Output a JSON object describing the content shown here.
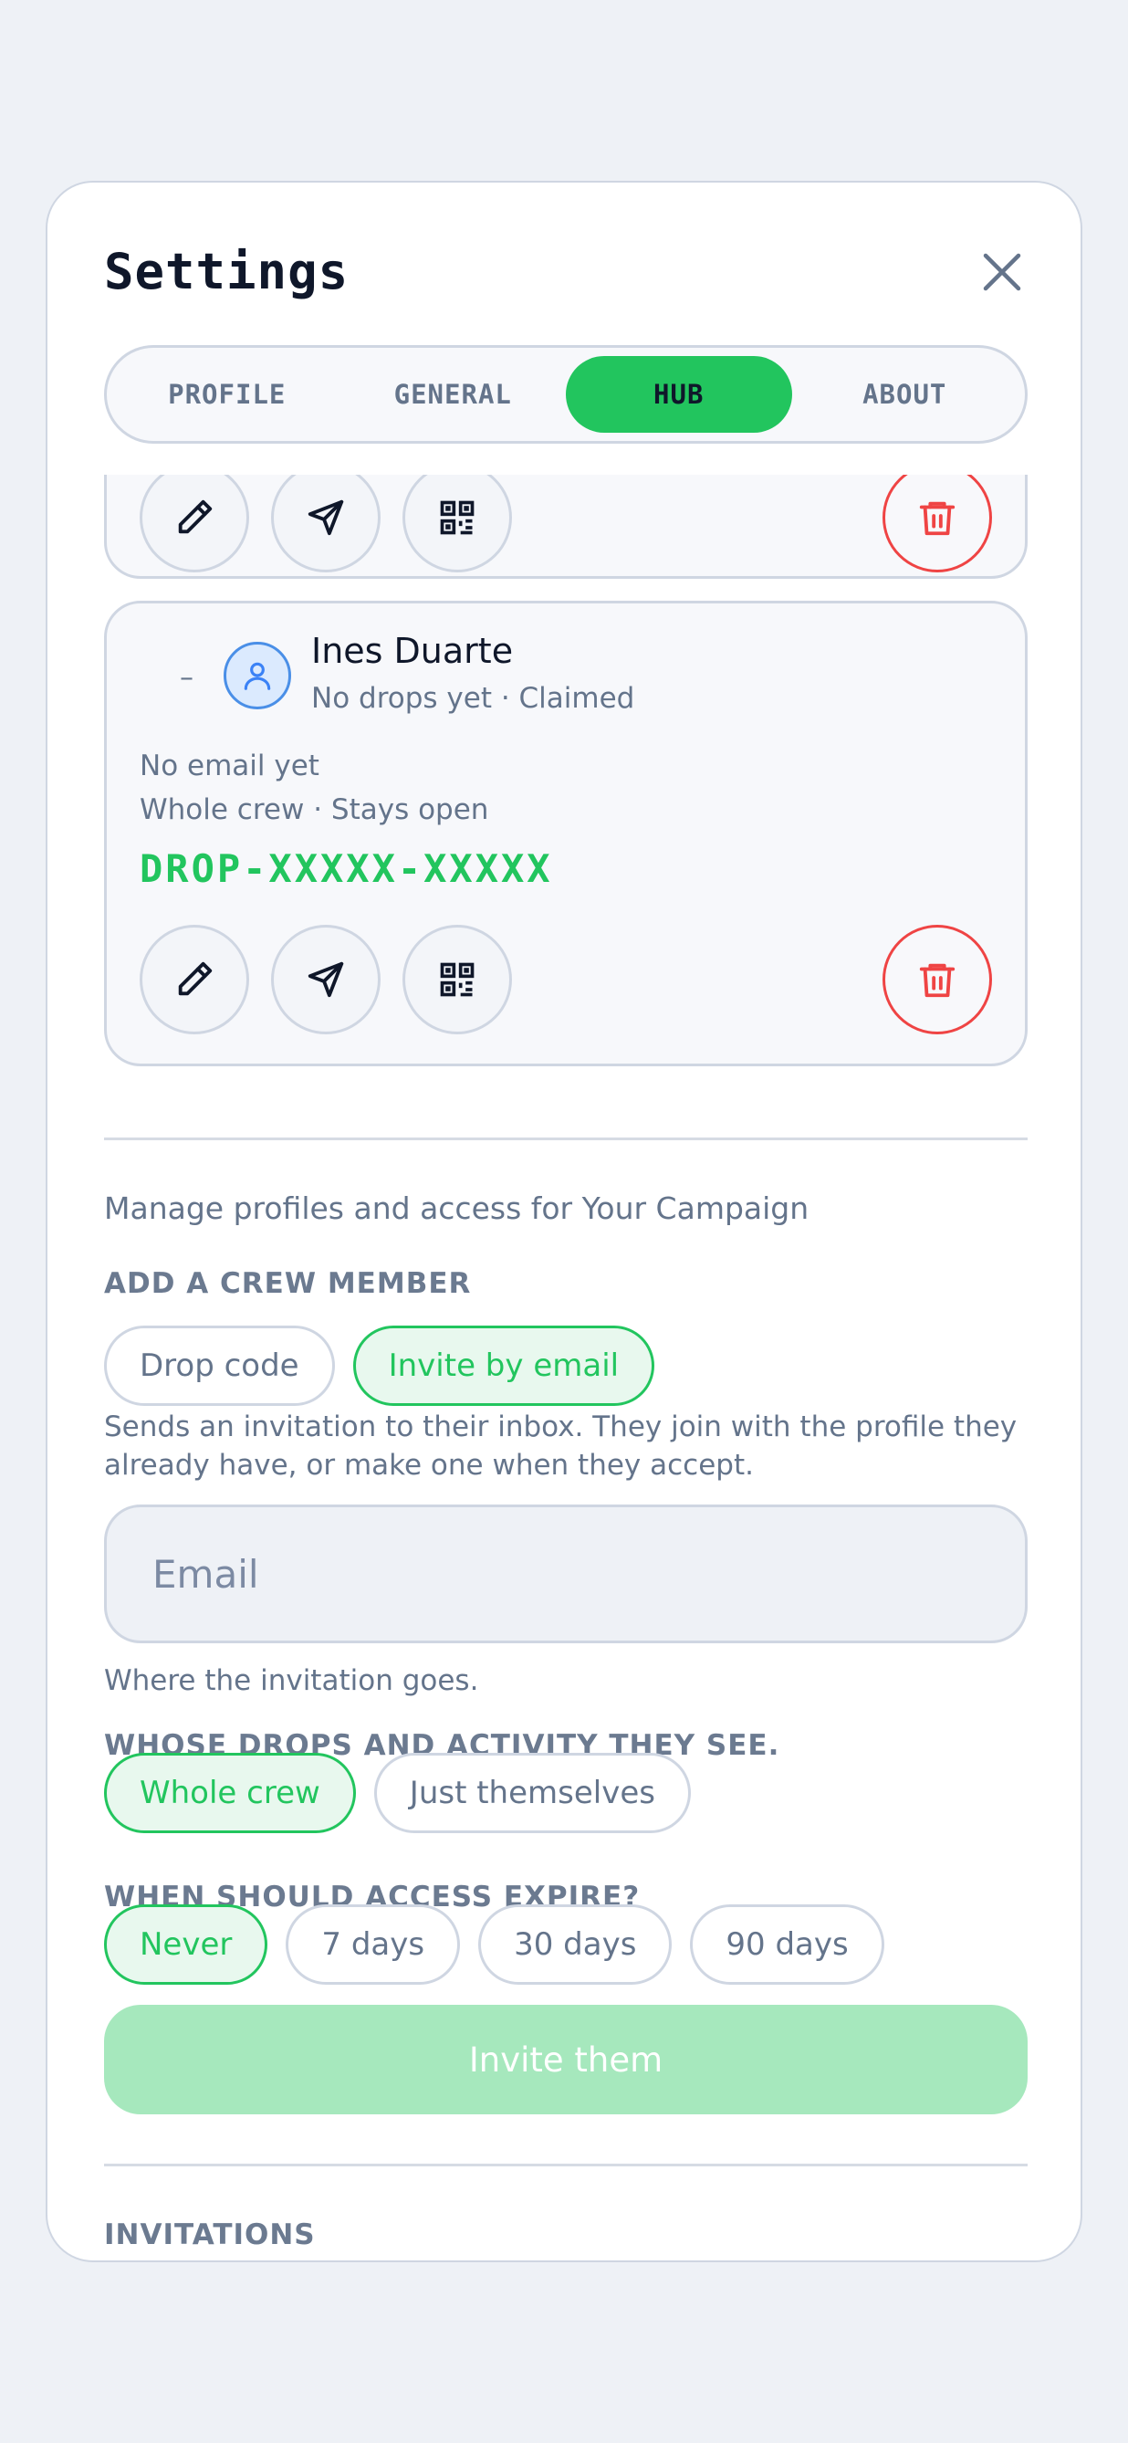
{
  "modal": {
    "title": "Settings"
  },
  "tabs": [
    {
      "label": "PROFILE",
      "active": false
    },
    {
      "label": "GENERAL",
      "active": false
    },
    {
      "label": "HUB",
      "active": true
    },
    {
      "label": "ABOUT",
      "active": false
    }
  ],
  "member": {
    "dash": "–",
    "name": "Ines Duarte",
    "status": "No drops yet · Claimed",
    "email": "No email yet",
    "scope": "Whole crew · Stays open",
    "code": "DROP-XXXXX-XXXXX"
  },
  "manage_text": "Manage profiles and access for Your Campaign",
  "add_member": {
    "heading": "ADD A CREW MEMBER",
    "modes": [
      "Drop code",
      "Invite by email"
    ],
    "help": "Sends an invitation to their inbox. They join with the profile they already have, or make one when they accept.",
    "email_placeholder": "Email",
    "email_value": "",
    "email_hint": "Where the invitation goes.",
    "visibility_heading": "WHOSE DROPS AND ACTIVITY THEY SEE.",
    "visibility_options": [
      "Whole crew",
      "Just themselves"
    ],
    "expiry_heading": "WHEN SHOULD ACCESS EXPIRE?",
    "expiry_options": [
      "Never",
      "7 days",
      "30 days",
      "90 days"
    ],
    "submit_label": "Invite them"
  },
  "invitations_heading": "INVITATIONS",
  "colors": {
    "accent": "#22c55e",
    "danger": "#ef4444",
    "muted": "#64748b",
    "border": "#cfd6e2"
  }
}
